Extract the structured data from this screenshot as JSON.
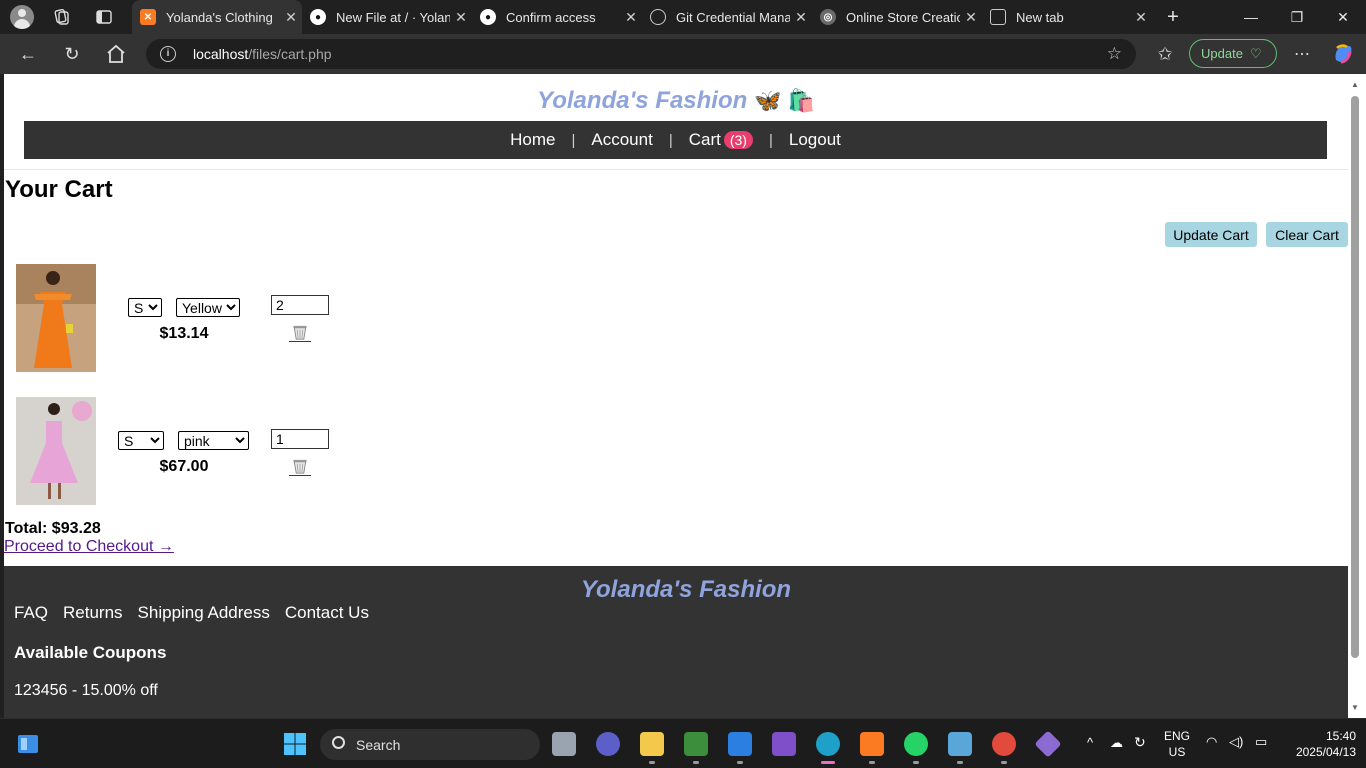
{
  "browser": {
    "tabs": [
      {
        "title": "Yolanda's Clothing",
        "active": true,
        "favicon": "xampp-icon"
      },
      {
        "title": "New File at / · Yolanda",
        "favicon": "github-icon"
      },
      {
        "title": "Confirm access",
        "favicon": "github-icon"
      },
      {
        "title": "Git Credential Manager",
        "favicon": "globe-icon"
      },
      {
        "title": "Online Store Creation",
        "favicon": "chatgpt-icon"
      },
      {
        "title": "New tab",
        "favicon": "newtab-icon"
      }
    ],
    "url_host": "localhost",
    "url_path": "/files/cart.php",
    "update_label": "Update"
  },
  "site": {
    "brand": "Yolanda's Fashion",
    "brand_emoji": "🦋 🛍️",
    "nav": {
      "home": "Home",
      "account": "Account",
      "cart": "Cart",
      "cart_count": "(3)",
      "logout": "Logout"
    }
  },
  "cart": {
    "title": "Your Cart",
    "update_label": "Update Cart",
    "clear_label": "Clear Cart",
    "items": [
      {
        "size": "S",
        "color": "Yellow",
        "price": "$13.14",
        "qty": "2",
        "image": "orange-dress-photo"
      },
      {
        "size": "S",
        "color": "pink",
        "price": "$67.00",
        "qty": "1",
        "image": "pink-dress-photo"
      }
    ],
    "total": "Total: $93.28",
    "checkout": "Proceed to Checkout →"
  },
  "footer": {
    "brand": "Yolanda's Fashion",
    "links": [
      "FAQ",
      "Returns",
      "Shipping Address",
      "Contact Us"
    ],
    "coupons_heading": "Available Coupons",
    "coupon": "123456 - 15.00% off"
  },
  "taskbar": {
    "search_label": "Search",
    "lang_top": "ENG",
    "lang_bottom": "US",
    "time": "15:40",
    "date": "2025/04/13"
  },
  "colors": {
    "brand": "#8fa3dc",
    "nav_bg": "#333333",
    "badge": "#e83e6d",
    "button": "#a8d5e2",
    "link": "#551a8b"
  }
}
